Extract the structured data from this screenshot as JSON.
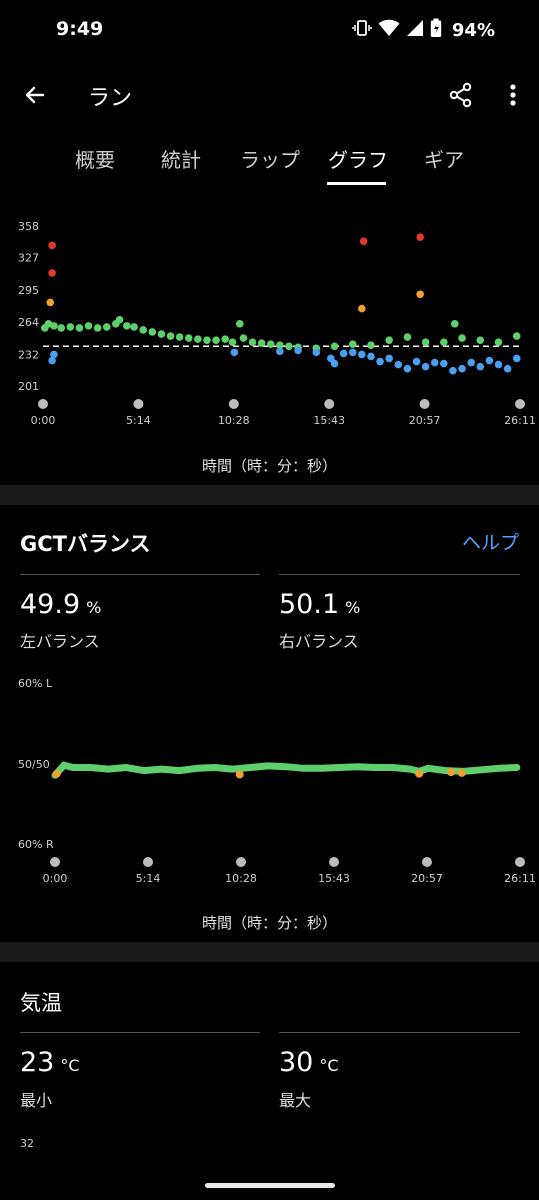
{
  "status": {
    "time": "9:49",
    "battery": "94%"
  },
  "app_bar": {
    "title": "ラン"
  },
  "tabs": [
    {
      "label": "概要"
    },
    {
      "label": "統計"
    },
    {
      "label": "ラップ"
    },
    {
      "label": "グラフ"
    },
    {
      "label": "ギア"
    }
  ],
  "chart1": {
    "x_axis_caption": "時間（時：分：秒）"
  },
  "gct": {
    "title": "GCTバランス",
    "help": "ヘルプ",
    "left_value": "49.9",
    "left_unit": "%",
    "left_label": "左バランス",
    "right_value": "50.1",
    "right_unit": "%",
    "right_label": "右バランス",
    "x_axis_caption": "時間（時：分：秒）"
  },
  "temp": {
    "title": "気温",
    "min_value": "23",
    "min_unit": "°C",
    "min_label": "最小",
    "max_value": "30",
    "max_unit": "°C",
    "max_label": "最大",
    "y_top_label": "32"
  },
  "colors": {
    "green": "#5ecf6a",
    "blue": "#4a9ff0",
    "orange": "#f0a030",
    "red": "#e03a2a",
    "link": "#4fa3ff"
  },
  "chart_data": [
    {
      "type": "scatter",
      "y_ticks": [
        "358",
        "327",
        "295",
        "264",
        "232",
        "201"
      ],
      "ylim": [
        201,
        358
      ],
      "x_ticks": [
        "0:00",
        "5:14",
        "10:28",
        "15:43",
        "20:57",
        "26:11"
      ],
      "reference_line": 240,
      "series": [
        {
          "color": "green",
          "values": [
            [
              0.1,
              258
            ],
            [
              0.3,
              262
            ],
            [
              0.6,
              260
            ],
            [
              1,
              258
            ],
            [
              1.5,
              259
            ],
            [
              2,
              258
            ],
            [
              2.5,
              260
            ],
            [
              3,
              258
            ],
            [
              3.5,
              259
            ],
            [
              4,
              262
            ],
            [
              4.2,
              266
            ],
            [
              4.6,
              260
            ],
            [
              5,
              259
            ],
            [
              5.5,
              256
            ],
            [
              6,
              254
            ],
            [
              6.5,
              252
            ],
            [
              7,
              250
            ],
            [
              7.5,
              249
            ],
            [
              8,
              248
            ],
            [
              8.5,
              247
            ],
            [
              9,
              246
            ],
            [
              9.5,
              246
            ],
            [
              10,
              247
            ],
            [
              10.4,
              244
            ],
            [
              10.8,
              262
            ],
            [
              11,
              248
            ],
            [
              11.5,
              244
            ],
            [
              12,
              243
            ],
            [
              12.5,
              242
            ],
            [
              13,
              241
            ],
            [
              13.5,
              240
            ],
            [
              14,
              239
            ],
            [
              15,
              238
            ],
            [
              16,
              240
            ],
            [
              17,
              242
            ],
            [
              18,
              241
            ],
            [
              19,
              246
            ],
            [
              20,
              249
            ],
            [
              21,
              244
            ],
            [
              22,
              244
            ],
            [
              22.6,
              262
            ],
            [
              23,
              248
            ],
            [
              24,
              246
            ],
            [
              25,
              244
            ],
            [
              26,
              250
            ]
          ]
        },
        {
          "color": "blue",
          "values": [
            [
              0.5,
              226
            ],
            [
              0.6,
              232
            ],
            [
              10.5,
              234
            ],
            [
              13,
              235
            ],
            [
              14,
              236
            ],
            [
              15,
              234
            ],
            [
              15.8,
              228
            ],
            [
              16,
              223
            ],
            [
              16.5,
              233
            ],
            [
              17,
              234
            ],
            [
              17.5,
              232
            ],
            [
              18,
              230
            ],
            [
              18.5,
              225
            ],
            [
              19,
              228
            ],
            [
              19.5,
              222
            ],
            [
              20,
              218
            ],
            [
              20.5,
              225
            ],
            [
              21,
              220
            ],
            [
              21.5,
              224
            ],
            [
              22,
              223
            ],
            [
              22.5,
              216
            ],
            [
              23,
              218
            ],
            [
              23.5,
              224
            ],
            [
              24,
              220
            ],
            [
              24.5,
              226
            ],
            [
              25,
              222
            ],
            [
              25.5,
              218
            ],
            [
              26,
              228
            ]
          ]
        },
        {
          "color": "orange",
          "values": [
            [
              0.4,
              283
            ],
            [
              17.5,
              277
            ],
            [
              20.7,
              291
            ]
          ]
        },
        {
          "color": "red",
          "values": [
            [
              0.5,
              339
            ],
            [
              0.5,
              312
            ],
            [
              17.6,
              343
            ],
            [
              20.7,
              347
            ]
          ]
        }
      ]
    },
    {
      "type": "line",
      "y_ticks": [
        "60% L",
        "50/50",
        "60% R"
      ],
      "ylim": [
        40,
        60
      ],
      "x_ticks": [
        "0:00",
        "5:14",
        "10:28",
        "15:43",
        "20:57",
        "26:11"
      ],
      "series": [
        {
          "color": "green",
          "x": [
            0,
            0.5,
            1,
            2,
            3,
            4,
            5,
            6,
            7,
            8,
            9,
            10,
            11,
            12,
            13,
            14,
            15,
            16,
            17,
            18,
            19,
            20,
            20.5,
            21,
            22,
            23,
            24,
            25,
            26
          ],
          "values": [
            49.0,
            50.3,
            50.0,
            50.0,
            49.8,
            50.0,
            49.6,
            49.8,
            49.6,
            49.9,
            50.0,
            49.8,
            50.0,
            50.2,
            50.1,
            49.9,
            49.9,
            50.0,
            50.1,
            50.0,
            50.0,
            49.8,
            49.5,
            49.9,
            49.6,
            49.5,
            49.7,
            49.9,
            50.0
          ]
        },
        {
          "color": "orange",
          "x": [
            0.1,
            10.4,
            20.5,
            22.3,
            22.9
          ],
          "values": [
            49.2,
            49.1,
            49.2,
            49.4,
            49.3
          ]
        }
      ]
    }
  ]
}
